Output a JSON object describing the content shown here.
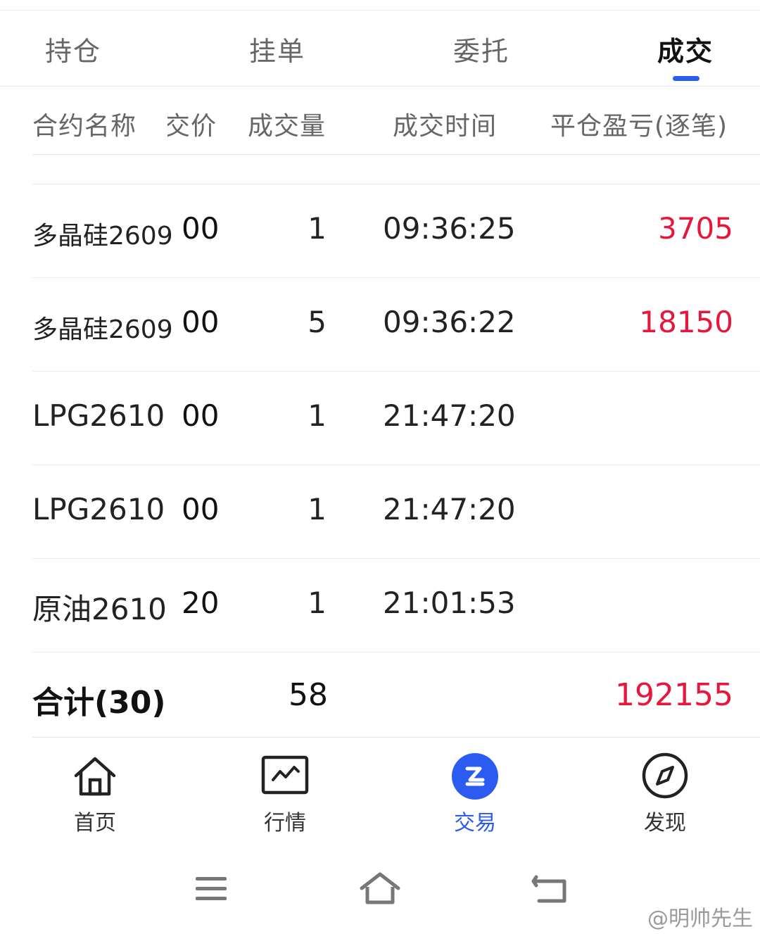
{
  "tabs": [
    {
      "label": "持仓",
      "active": false
    },
    {
      "label": "挂单",
      "active": false
    },
    {
      "label": "委托",
      "active": false
    },
    {
      "label": "成交",
      "active": true
    }
  ],
  "columns": {
    "name": "合约名称",
    "price": "交价",
    "qty": "成交量",
    "time": "成交时间",
    "pnl": "平仓盈亏(逐笔)"
  },
  "rows": [
    {
      "name": "多晶硅2609",
      "price": "00",
      "qty": "1",
      "time": "09:36:25",
      "pnl": "3705"
    },
    {
      "name": "多晶硅2609",
      "price": "00",
      "qty": "5",
      "time": "09:36:22",
      "pnl": "18150"
    },
    {
      "name": "LPG2610",
      "price": "00",
      "qty": "1",
      "time": "21:47:20",
      "pnl": ""
    },
    {
      "name": "LPG2610",
      "price": "00",
      "qty": "1",
      "time": "21:47:20",
      "pnl": ""
    },
    {
      "name": "原油2610",
      "price": "20",
      "qty": "1",
      "time": "21:01:53",
      "pnl": ""
    }
  ],
  "total": {
    "label": "合计(30)",
    "qty": "58",
    "pnl": "192155"
  },
  "nav": [
    {
      "label": "首页",
      "icon": "home-icon",
      "active": false
    },
    {
      "label": "行情",
      "icon": "chart-icon",
      "active": false
    },
    {
      "label": "交易",
      "icon": "trade-icon",
      "active": true
    },
    {
      "label": "发现",
      "icon": "compass-icon",
      "active": false
    }
  ],
  "system_bar": [
    "menu-icon",
    "home-outline-icon",
    "back-icon"
  ],
  "watermark": "@明帅先生",
  "colors": {
    "accent": "#2b5bf0",
    "profit": "#e8163a",
    "text": "#222222",
    "muted": "#666666"
  }
}
